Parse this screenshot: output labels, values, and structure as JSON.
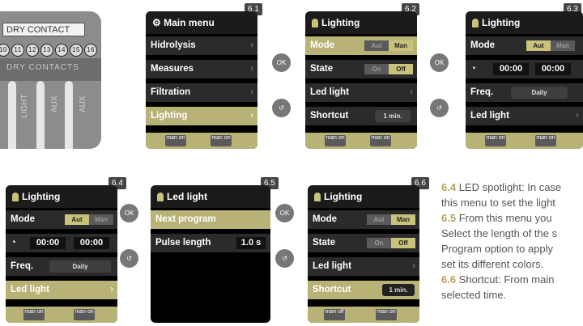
{
  "photo": {
    "label": "DRY CONTACT",
    "numbers": [
      "10",
      "11",
      "12",
      "13",
      "14",
      "15",
      "16"
    ],
    "strip_text": "DRY CONTACTS",
    "vertical": [
      "LIGHT",
      "AUX",
      "AUX"
    ]
  },
  "buttons": {
    "ok": "OK",
    "back": "↺"
  },
  "screens": {
    "s61": {
      "tag": "6.1",
      "title": "Main menu",
      "items": [
        "Hidrolysis",
        "Measures",
        "Filtration",
        "Lighting"
      ]
    },
    "s62": {
      "tag": "6.2",
      "title": "Lighting",
      "rows": {
        "mode": "Mode",
        "state": "State",
        "led": "Led light",
        "shortcut": "Shortcut"
      },
      "mode_sw": [
        "Aut",
        "Man"
      ],
      "state_sw": [
        "On",
        "Off"
      ],
      "shortcut_val": "1 min."
    },
    "s63": {
      "tag": "6.3",
      "title": "Lighting",
      "mode": "Mode",
      "mode_sw": [
        "Aut",
        "Man"
      ],
      "time1": "00:00",
      "time2": "00:00",
      "freq": "Freq.",
      "freq_val": "Daily",
      "led": "Led light"
    },
    "s64": {
      "tag": "6.4",
      "title": "Lighting",
      "mode": "Mode",
      "mode_sw": [
        "Aut",
        "Man"
      ],
      "time1": "00:00",
      "time2": "00:00",
      "freq": "Freq.",
      "freq_val": "Daily",
      "led": "Led light"
    },
    "s65": {
      "tag": "6.5",
      "title": "Led light",
      "next": "Next program",
      "pulse": "Pulse length",
      "pulse_val": "1.0 s"
    },
    "s66": {
      "tag": "6.6",
      "title": "Lighting",
      "rows": {
        "mode": "Mode",
        "state": "State",
        "led": "Led light",
        "shortcut": "Shortcut"
      },
      "mode_sw": [
        "Aut",
        "Man"
      ],
      "state_sw": [
        "On",
        "Off"
      ],
      "shortcut_val": "1 min."
    }
  },
  "footer": {
    "a": "man on",
    "b": "man on",
    "c": "man off"
  },
  "desc": {
    "l1b": "6.4",
    "l1": "LED spotlight: In case",
    "l2": "this menu to set the light",
    "l3b": "6.5",
    "l3": "From this menu you",
    "l4": "Select the length of the s",
    "l5": "Program option to apply",
    "l6": "set its different colors.",
    "l7b": "6.6",
    "l7": "Shortcut: From main",
    "l8": "selected time."
  }
}
